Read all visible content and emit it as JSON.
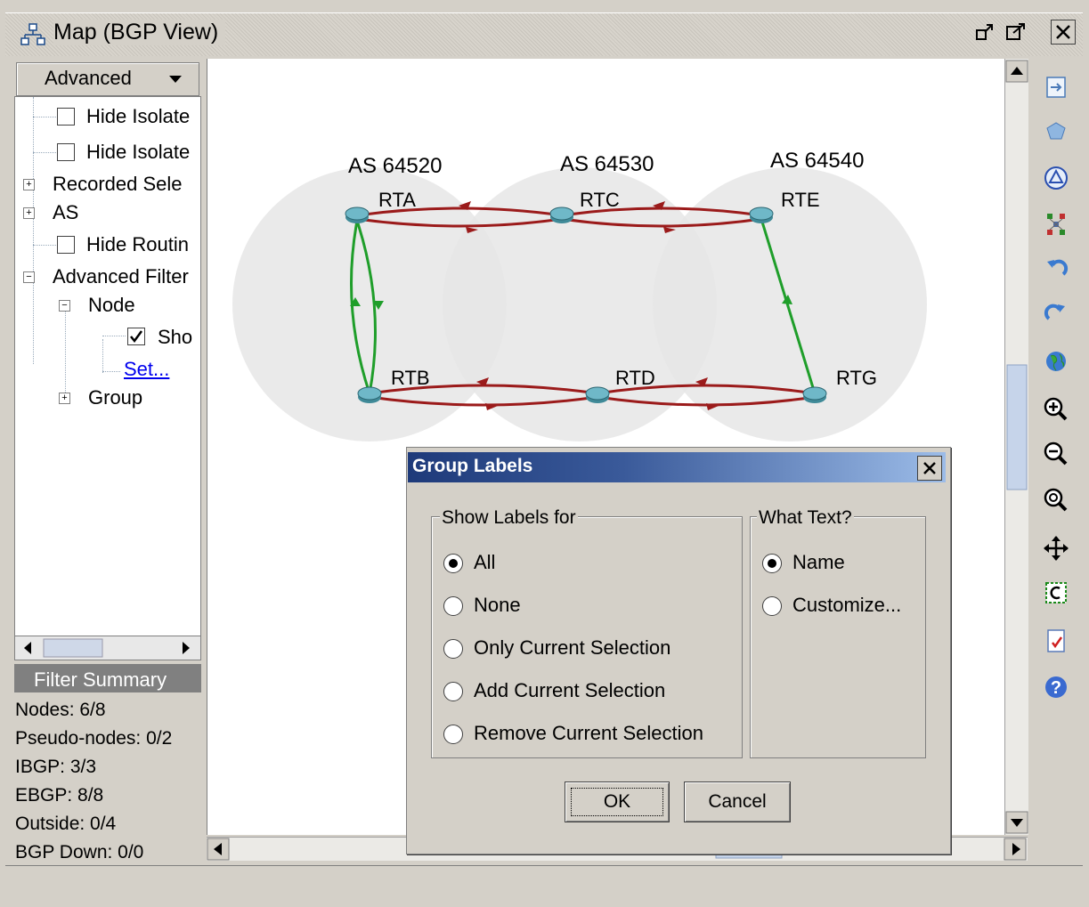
{
  "window": {
    "title": "Map (BGP View)",
    "icons": [
      "network-icon",
      "restore-icon",
      "maximize-icon",
      "close-icon"
    ]
  },
  "left_panel": {
    "dropdown_label": "Advanced",
    "tree": [
      {
        "label": "Hide Isolate",
        "type": "checkbox",
        "checked": false
      },
      {
        "label": "Hide Isolate",
        "type": "checkbox",
        "checked": false
      },
      {
        "label": "Recorded Sele",
        "type": "expandable",
        "expanded": false
      },
      {
        "label": "AS",
        "type": "expandable",
        "expanded": false
      },
      {
        "label": "Hide Routin",
        "type": "checkbox",
        "checked": false
      },
      {
        "label": "Advanced Filter",
        "type": "expandable",
        "expanded": true
      },
      {
        "label": "Node",
        "type": "expandable",
        "expanded": true
      },
      {
        "label": "Sho",
        "type": "checkbox",
        "checked": true
      },
      {
        "label": "Set...",
        "type": "link"
      },
      {
        "label": "Group",
        "type": "expandable",
        "expanded": false
      }
    ],
    "filter_summary": {
      "title": "Filter Summary",
      "lines": [
        "Nodes: 6/8",
        "Pseudo-nodes: 0/2",
        "IBGP: 3/3",
        "EBGP: 8/8",
        "Outside: 0/4",
        "BGP Down: 0/0"
      ]
    }
  },
  "map": {
    "as_groups": [
      {
        "label": "AS 64520"
      },
      {
        "label": "AS 64530"
      },
      {
        "label": "AS 64540"
      }
    ],
    "routers": [
      "RTA",
      "RTC",
      "RTE",
      "RTB",
      "RTD",
      "RTG"
    ],
    "colors": {
      "ebgp": "#9b1b1b",
      "ibgp": "#1f9e2a",
      "group_fill": "#e6e6e6"
    }
  },
  "toolbar": {
    "icons": [
      "fit-icon",
      "shape-icon",
      "layout-icon",
      "tree-layout-icon",
      "undo-icon",
      "redo-icon",
      "globe-icon",
      "zoom-in-icon",
      "zoom-out-icon",
      "zoom-fit-icon",
      "pan-icon",
      "select-icon",
      "report-icon",
      "help-icon"
    ]
  },
  "dialog": {
    "title": "Group Labels",
    "show_labels_for": {
      "title": "Show Labels for",
      "options": [
        "All",
        "None",
        "Only Current Selection",
        "Add Current Selection",
        "Remove Current Selection"
      ],
      "selected": "All"
    },
    "what_text": {
      "title": "What Text?",
      "options": [
        "Name",
        "Customize..."
      ],
      "selected": "Name"
    },
    "ok_label": "OK",
    "cancel_label": "Cancel"
  }
}
